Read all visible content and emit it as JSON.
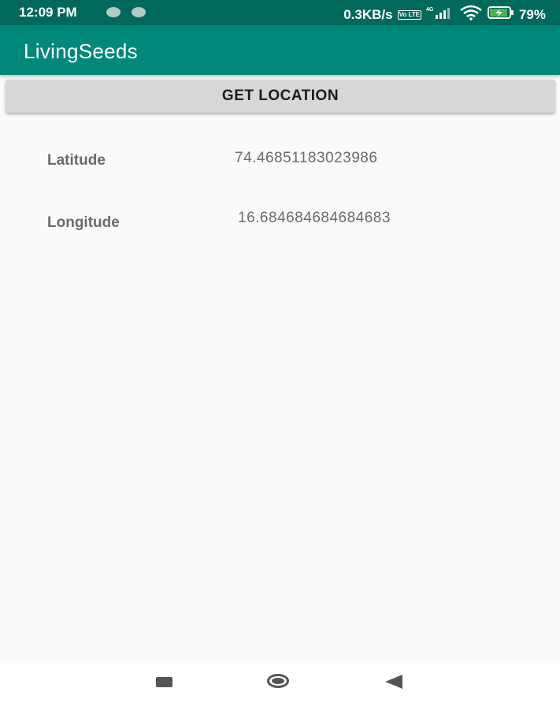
{
  "status_bar": {
    "time": "12:09 PM",
    "network_speed": "0.3KB/s",
    "volte_label": "Vo LTE",
    "network_type": "4G",
    "battery_percent": "79%",
    "icons": [
      "notification-dot-icon",
      "notification-dot-icon",
      "volte-icon",
      "signal-icon",
      "wifi-icon",
      "battery-charging-icon"
    ]
  },
  "app_bar": {
    "title": "LivingSeeds"
  },
  "actions": {
    "get_location_label": "GET LOCATION"
  },
  "location": {
    "latitude_label": "Latitude",
    "latitude_value": "74.46851183023986",
    "longitude_label": "Longitude",
    "longitude_value": "16.684684684684683"
  },
  "nav_bar": {
    "icons": [
      "recents-icon",
      "home-icon",
      "back-icon"
    ]
  },
  "colors": {
    "status_bar": "#00695c",
    "app_bar": "#00897b",
    "background": "#fafafa",
    "button": "#d6d7d7",
    "text_gray": "#6b6b6b"
  }
}
